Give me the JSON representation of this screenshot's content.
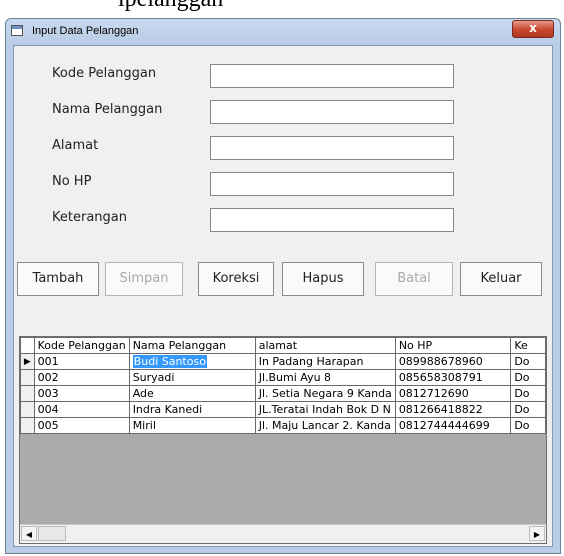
{
  "caption": "lpelanggan",
  "window": {
    "title": "Input Data Pelanggan",
    "close_glyph": "x"
  },
  "form": {
    "fields": [
      {
        "label": "Kode Pelanggan",
        "value": ""
      },
      {
        "label": "Nama Pelanggan",
        "value": ""
      },
      {
        "label": "Alamat",
        "value": ""
      },
      {
        "label": "No HP",
        "value": ""
      },
      {
        "label": "Keterangan",
        "value": ""
      }
    ]
  },
  "buttons": {
    "tambah": "Tambah",
    "simpan": "Simpan",
    "koreksi": "Koreksi",
    "hapus": "Hapus",
    "batal": "Batal",
    "keluar": "Keluar"
  },
  "grid": {
    "columns": [
      "Kode Pelanggan",
      "Nama Pelanggan",
      "alamat",
      "No HP",
      "Ke"
    ],
    "current_row_marker": "▶",
    "rows": [
      {
        "kode": "001",
        "nama": "Budi Santoso",
        "alamat": "In Padang Harapan",
        "nohp": "089988678960",
        "ket": "Do"
      },
      {
        "kode": "002",
        "nama": "Suryadi",
        "alamat": "Jl.Bumi Ayu 8",
        "nohp": "085658308791",
        "ket": "Do"
      },
      {
        "kode": "003",
        "nama": "Ade",
        "alamat": "Jl. Setia Negara 9 Kanda",
        "nohp": "0812712690",
        "ket": "Do"
      },
      {
        "kode": "004",
        "nama": "Indra Kanedi",
        "alamat": "JL.Teratai Indah Bok D N",
        "nohp": "081266418822",
        "ket": "Do"
      },
      {
        "kode": "005",
        "nama": "Miril",
        "alamat": "Jl. Maju Lancar 2. Kanda",
        "nohp": "0812744444699",
        "ket": "Do"
      }
    ],
    "scroll_left_glyph": "◀",
    "scroll_right_glyph": "▶"
  }
}
